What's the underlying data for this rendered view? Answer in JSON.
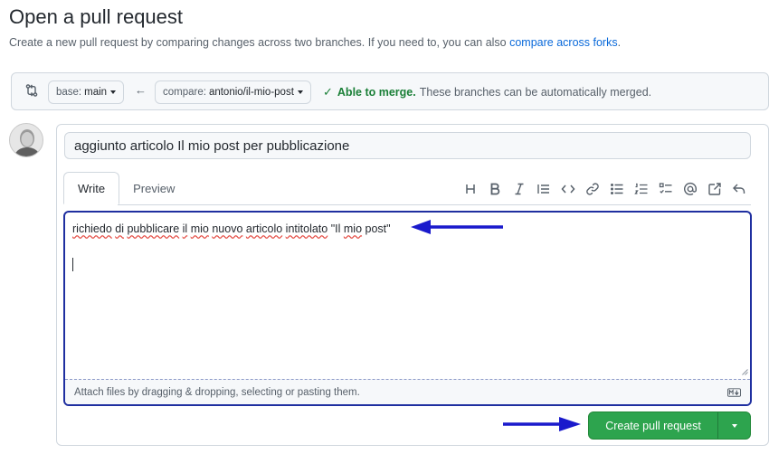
{
  "header": {
    "title": "Open a pull request",
    "subtitle_prefix": "Create a new pull request by comparing changes across two branches. If you need to, you can also ",
    "subtitle_link": "compare across forks",
    "subtitle_suffix": "."
  },
  "range": {
    "base_label": "base:",
    "base_value": "main",
    "compare_label": "compare:",
    "compare_value": "antonio/il-mio-post",
    "merge_ok": "Able to merge.",
    "merge_text": "These branches can be automatically merged."
  },
  "form": {
    "title_value": "aggiunto articolo Il mio post per pubblicazione",
    "tabs": [
      "Write",
      "Preview"
    ],
    "active_tab": "Write",
    "toolbar_icons": [
      "heading-icon",
      "bold-icon",
      "italic-icon",
      "quote-icon",
      "code-icon",
      "link-icon",
      "unordered-list-icon",
      "ordered-list-icon",
      "task-list-icon",
      "mention-icon",
      "reference-icon",
      "reply-icon"
    ],
    "body_words": [
      "richiedo",
      "di",
      "pubblicare",
      "il",
      "mio",
      "nuovo",
      "articolo",
      "intitolato",
      "\"Il",
      "mio",
      "post\""
    ],
    "attach_text": "Attach files by dragging & dropping, selecting or pasting them.",
    "submit_label": "Create pull request"
  },
  "colors": {
    "accent": "#0969da",
    "success": "#2da44e",
    "annotation_arrow": "#1a1acc"
  }
}
